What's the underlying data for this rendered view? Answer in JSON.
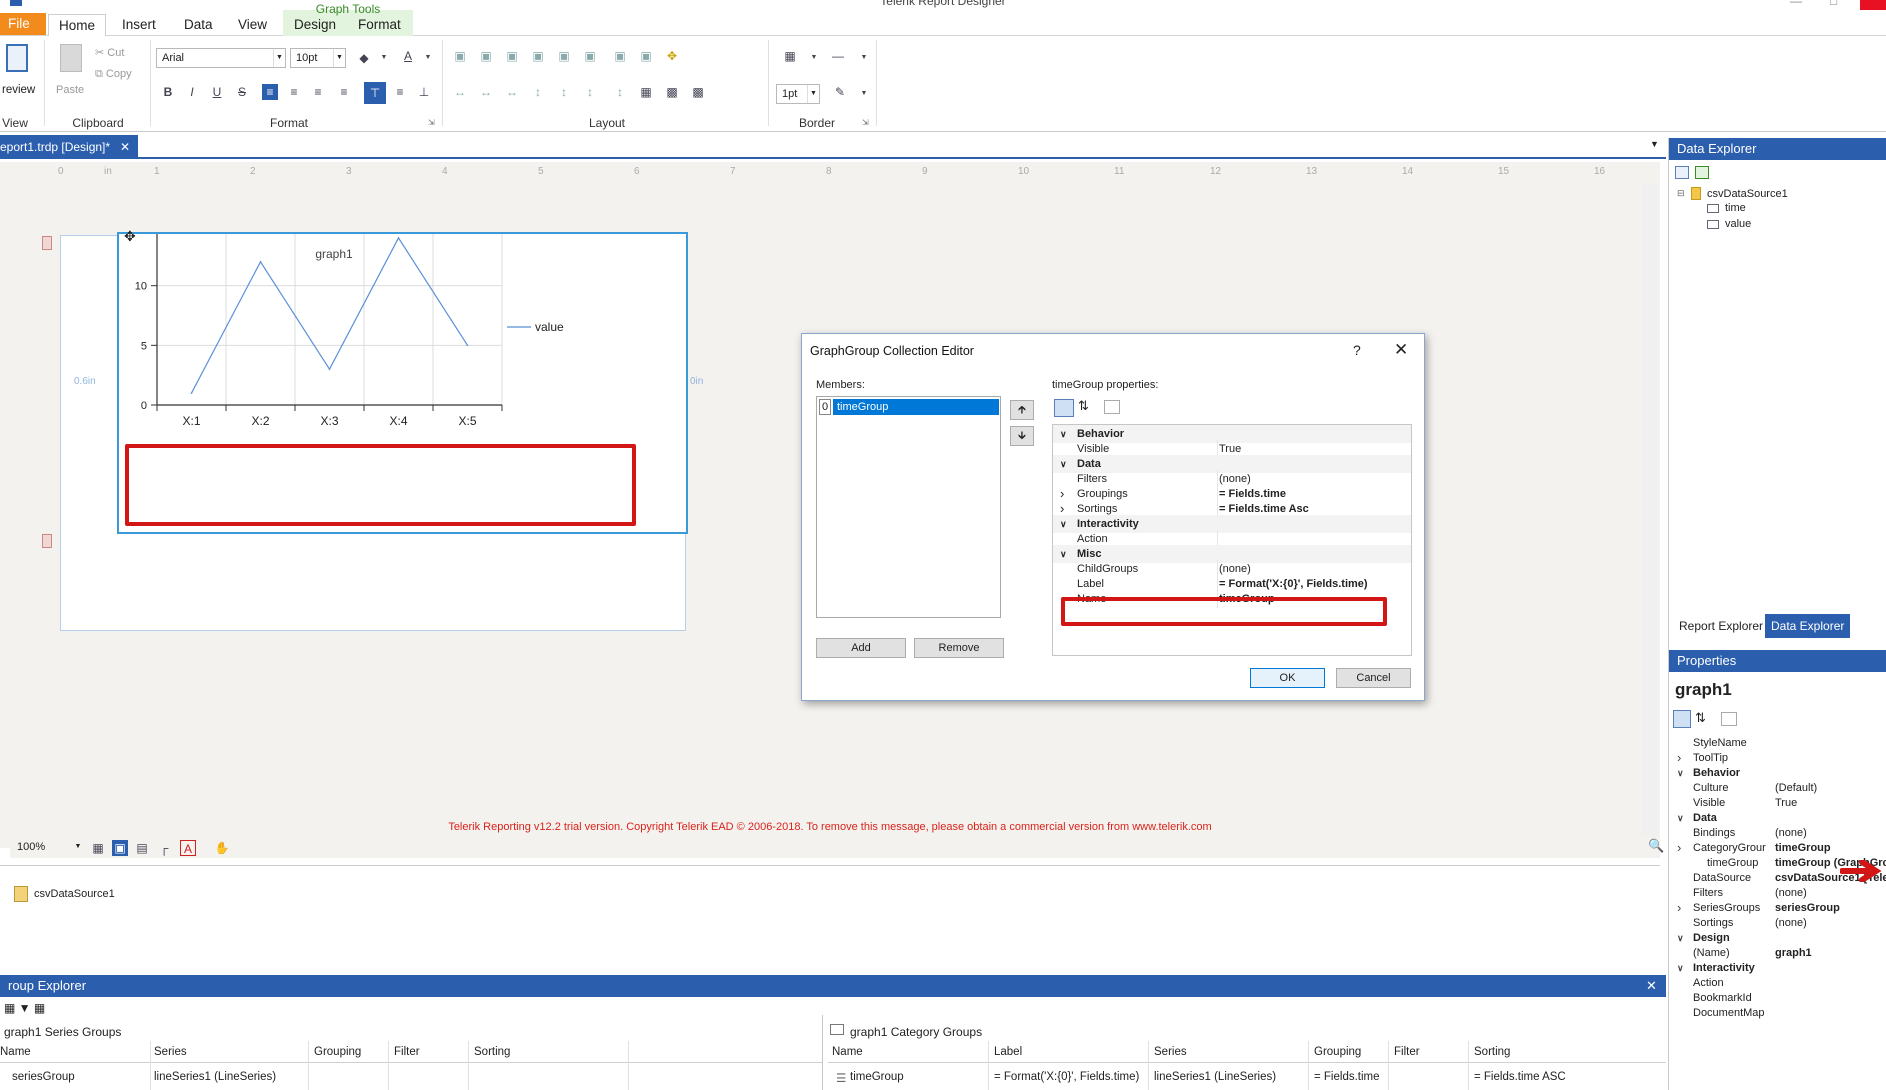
{
  "window": {
    "title": "Telerik Report Designer",
    "context_tab_group": "Graph Tools"
  },
  "tabs": [
    {
      "label": "File"
    },
    {
      "label": "Home"
    },
    {
      "label": "Insert"
    },
    {
      "label": "Data"
    },
    {
      "label": "View"
    },
    {
      "label": "Design"
    },
    {
      "label": "Format"
    }
  ],
  "ribbon": {
    "view_label": "View",
    "preview_label": "review",
    "clipboard": {
      "label": "Clipboard",
      "paste": "Paste",
      "cut": "Cut",
      "copy": "Copy"
    },
    "format": {
      "label": "Format",
      "font": "Arial",
      "size": "10pt"
    },
    "layout": {
      "label": "Layout"
    },
    "border": {
      "label": "Border",
      "width": "1pt"
    }
  },
  "document_tab": {
    "label": "eport1.trdp [Design]*"
  },
  "ruler_marks": [
    "0",
    "in",
    "1",
    "2",
    "3",
    "4",
    "5",
    "6",
    "7",
    "8",
    "9",
    "10",
    "11",
    "12",
    "13",
    "14",
    "15",
    "16"
  ],
  "design": {
    "margin_label_left": "0.6in",
    "margin_label_right": "0in",
    "zoom": "100%",
    "trial_message": "Telerik Reporting v12.2 trial version. Copyright Telerik EAD © 2006-2018. To remove this message, please obtain a commercial version from www.telerik.com"
  },
  "chart_data": {
    "type": "line",
    "title": "graph1",
    "categories": [
      "X:1",
      "X:2",
      "X:3",
      "X:4",
      "X:5"
    ],
    "series": [
      {
        "name": "value",
        "values": [
          1,
          12,
          3,
          14,
          5
        ]
      }
    ],
    "ylim": [
      0,
      15
    ],
    "yticks": [
      0,
      5,
      10,
      15
    ],
    "grid": true,
    "legend_position": "right",
    "color": "#5b8fd6"
  },
  "tray": {
    "item": "csvDataSource1"
  },
  "group_explorer": {
    "title": "roup Explorer",
    "series_groups": {
      "title": "graph1 Series Groups",
      "columns": [
        "Name",
        "Series",
        "Grouping",
        "Filter",
        "Sorting"
      ],
      "rows": [
        {
          "name": "seriesGroup",
          "series": "lineSeries1 (LineSeries)",
          "grouping": "",
          "filter": "",
          "sorting": ""
        }
      ]
    },
    "category_groups": {
      "title": "graph1 Category Groups",
      "columns": [
        "Name",
        "Label",
        "Series",
        "Grouping",
        "Filter",
        "Sorting"
      ],
      "rows": [
        {
          "name": "timeGroup",
          "label": "= Format('X:{0}', Fields.time)",
          "series": "lineSeries1 (LineSeries)",
          "grouping": "= Fields.time",
          "filter": "",
          "sorting": "= Fields.time ASC"
        }
      ]
    }
  },
  "data_explorer": {
    "title": "Data Explorer",
    "source": "csvDataSource1",
    "fields": [
      "time",
      "value"
    ],
    "tab_report": "Report Explorer",
    "tab_data": "Data Explorer"
  },
  "properties": {
    "title": "Properties",
    "object": "graph1",
    "rows": [
      {
        "kind": "prop",
        "name": "StyleName",
        "value": ""
      },
      {
        "kind": "prop",
        "name": "ToolTip",
        "value": "",
        "expand": true
      },
      {
        "kind": "cat",
        "name": "Behavior"
      },
      {
        "kind": "prop",
        "name": "Culture",
        "value": "(Default)"
      },
      {
        "kind": "prop",
        "name": "Visible",
        "value": "True"
      },
      {
        "kind": "cat",
        "name": "Data"
      },
      {
        "kind": "prop",
        "name": "Bindings",
        "value": "(none)"
      },
      {
        "kind": "prop",
        "name": "CategoryGrour",
        "value": "timeGroup",
        "expand": true,
        "bold": true
      },
      {
        "kind": "prop",
        "name": "timeGroup",
        "value": "timeGroup (GraphGro",
        "sub": true,
        "bold": true
      },
      {
        "kind": "prop",
        "name": "DataSource",
        "value": "csvDataSource1 [Teler",
        "bold": true
      },
      {
        "kind": "prop",
        "name": "Filters",
        "value": "(none)"
      },
      {
        "kind": "prop",
        "name": "SeriesGroups",
        "value": "seriesGroup",
        "expand": true,
        "bold": true
      },
      {
        "kind": "prop",
        "name": "Sortings",
        "value": "(none)"
      },
      {
        "kind": "cat",
        "name": "Design"
      },
      {
        "kind": "prop",
        "name": "(Name)",
        "value": "graph1",
        "bold": true
      },
      {
        "kind": "cat",
        "name": "Interactivity"
      },
      {
        "kind": "prop",
        "name": "Action",
        "value": ""
      },
      {
        "kind": "prop",
        "name": "BookmarkId",
        "value": ""
      },
      {
        "kind": "prop",
        "name": "DocumentMap",
        "value": ""
      }
    ]
  },
  "dialog": {
    "title": "GraphGroup Collection Editor",
    "help": "?",
    "members_label": "Members:",
    "member_index": "0",
    "member_name": "timeGroup",
    "props_label": "timeGroup properties:",
    "add": "Add",
    "remove": "Remove",
    "ok": "OK",
    "cancel": "Cancel",
    "rows": [
      {
        "kind": "cat",
        "name": "Behavior"
      },
      {
        "kind": "prop",
        "name": "Visible",
        "value": "True"
      },
      {
        "kind": "cat",
        "name": "Data"
      },
      {
        "kind": "prop",
        "name": "Filters",
        "value": "(none)"
      },
      {
        "kind": "prop",
        "name": "Groupings",
        "value": "= Fields.time",
        "expand": true,
        "bold": true
      },
      {
        "kind": "prop",
        "name": "Sortings",
        "value": "= Fields.time Asc",
        "expand": true,
        "bold": true
      },
      {
        "kind": "cat",
        "name": "Interactivity"
      },
      {
        "kind": "prop",
        "name": "Action",
        "value": ""
      },
      {
        "kind": "cat",
        "name": "Misc"
      },
      {
        "kind": "prop",
        "name": "ChildGroups",
        "value": "(none)"
      },
      {
        "kind": "prop",
        "name": "Label",
        "value": "= Format('X:{0}', Fields.time)",
        "bold": true
      },
      {
        "kind": "prop",
        "name": "Name",
        "value": "timeGroup",
        "bold": true
      }
    ]
  },
  "annotation_color": "#d21515",
  "accent_color": "#2b5ead"
}
